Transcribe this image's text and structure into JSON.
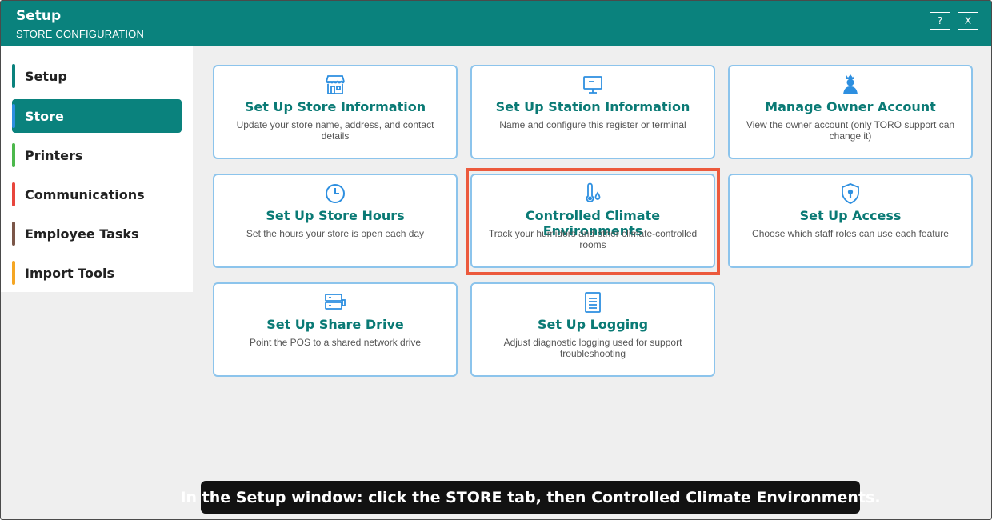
{
  "window": {
    "title": "Setup",
    "subtitle": "STORE CONFIGURATION",
    "help_label": "?",
    "close_label": "X"
  },
  "sidebar": {
    "items": [
      {
        "label": "Setup",
        "color": "#0a827d"
      },
      {
        "label": "Store",
        "color": "#2d8fe0",
        "active": true
      },
      {
        "label": "Printers",
        "color": "#4cb84c"
      },
      {
        "label": "Communications",
        "color": "#e8453c"
      },
      {
        "label": "Employee Tasks",
        "color": "#7b5648"
      },
      {
        "label": "Import Tools",
        "color": "#f5a623"
      }
    ]
  },
  "cards": [
    {
      "icon": "storefront-icon",
      "title": "Set Up Store Information",
      "desc": "Update your store name, address, and contact details"
    },
    {
      "icon": "monitor-icon",
      "title": "Set Up Station Information",
      "desc": "Name and configure this register or terminal"
    },
    {
      "icon": "owner-crown-icon",
      "title": "Manage Owner Account",
      "desc": "View the owner account (only TORO support can change it)"
    },
    {
      "icon": "clock-icon",
      "title": "Set Up Store Hours",
      "desc": "Set the hours your store is open each day"
    },
    {
      "icon": "thermometer-droplet-icon",
      "title": "Controlled Climate Environments",
      "desc": "Track your humidors and other climate-controlled rooms"
    },
    {
      "icon": "shield-keyhole-icon",
      "title": "Set Up Access",
      "desc": "Choose which staff roles can use each feature"
    },
    {
      "icon": "server-drive-icon",
      "title": "Set Up Share Drive",
      "desc": "Point the POS to a shared network drive"
    },
    {
      "icon": "document-log-icon",
      "title": "Set Up Logging",
      "desc": "Adjust diagnostic logging used for support troubleshooting"
    }
  ],
  "caption": "In the Setup window: click the STORE tab, then Controlled Climate Environments.",
  "colors": {
    "titlebar": "#0a827d",
    "card_title": "#0a7a75",
    "card_border": "#8cc4ec",
    "icon": "#2d8fe0",
    "highlight": "#ec5a3d"
  }
}
